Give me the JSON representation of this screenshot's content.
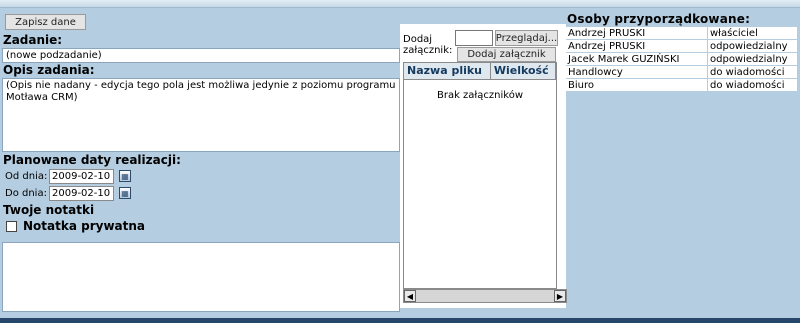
{
  "toolbar": {
    "save_label": "Zapisz dane"
  },
  "task": {
    "heading": "Zadanie:",
    "value": "(nowe podzadanie)",
    "description_heading": "Opis zadania:",
    "description_text": "(Opis nie nadany - edycja tego pola jest możliwa jedynie z poziomu programu Motława CRM)"
  },
  "dates": {
    "heading": "Planowane daty realizacji:",
    "from_label": "Od dnia:",
    "from_value": "2009-02-10",
    "to_label": "Do dnia:",
    "to_value": "2009-02-10"
  },
  "notes": {
    "heading": "Twoje notatki",
    "private_label": "Notatka prywatna",
    "private_checked": false,
    "text": ""
  },
  "attachments": {
    "add_label_1": "Dodaj",
    "add_label_2": "załącznik:",
    "browse_label": "Przeglądaj...",
    "add_button_label": "Dodaj załącznik",
    "col_name": "Nazwa pliku",
    "col_size": "Wielkość",
    "empty_text": "Brak załączników"
  },
  "people": {
    "heading": "Osoby przyporządkowane:",
    "rows": [
      {
        "name": "Andrzej PRUSKI",
        "role": "właściciel"
      },
      {
        "name": "Andrzej PRUSKI",
        "role": "odpowiedzialny"
      },
      {
        "name": "Jacek Marek GUZIŃSKI",
        "role": "odpowiedzialny"
      },
      {
        "name": "Handlowcy",
        "role": "do wiadomości"
      },
      {
        "name": "Biuro",
        "role": "do wiadomości"
      }
    ]
  },
  "icons": {
    "calendar": "calendar-icon",
    "scroll_left": "◀",
    "scroll_right": "▶"
  }
}
